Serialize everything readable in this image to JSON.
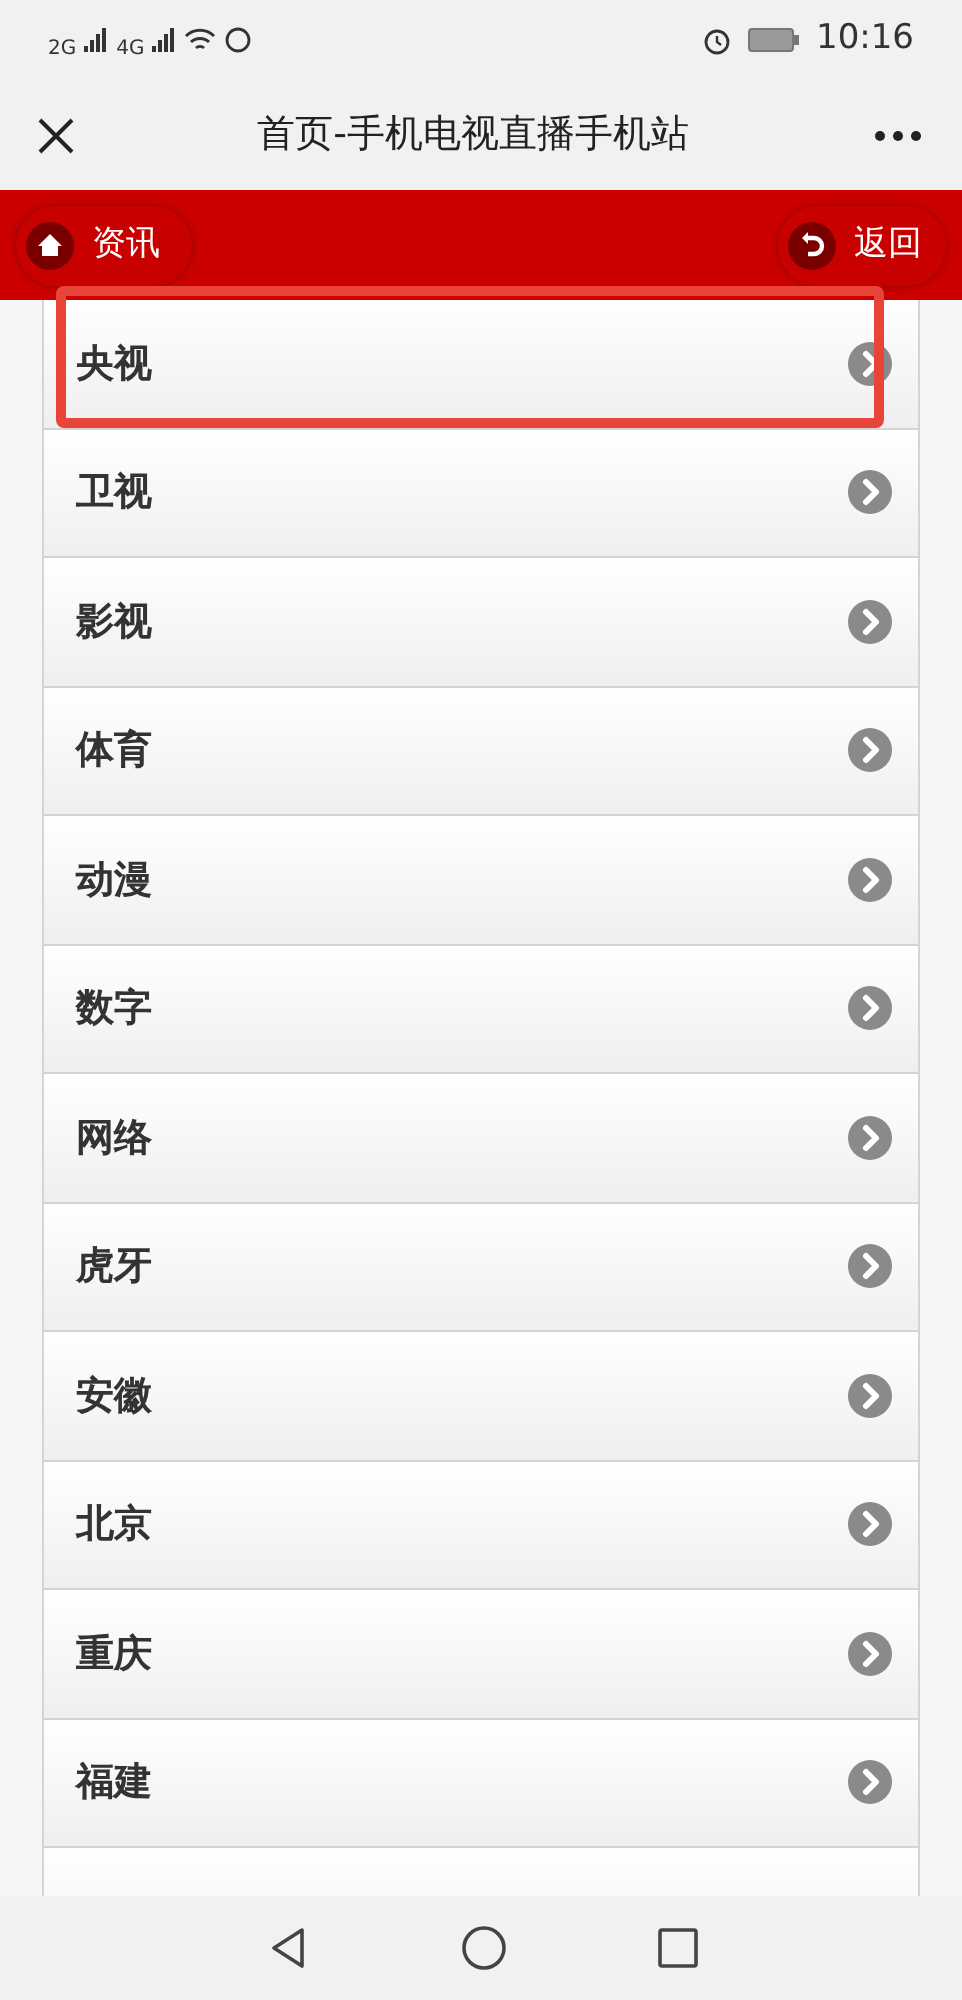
{
  "status_bar": {
    "signal_1": "2G",
    "signal_2": "4G",
    "time": "10:16"
  },
  "title_bar": {
    "title": "首页-手机电视直播手机站"
  },
  "header": {
    "left_button": "资讯",
    "right_button": "返回"
  },
  "categories": [
    {
      "label": "央视"
    },
    {
      "label": "卫视"
    },
    {
      "label": "影视"
    },
    {
      "label": "体育"
    },
    {
      "label": "动漫"
    },
    {
      "label": "数字"
    },
    {
      "label": "网络"
    },
    {
      "label": "虎牙"
    },
    {
      "label": "安徽"
    },
    {
      "label": "北京"
    },
    {
      "label": "重庆"
    },
    {
      "label": "福建"
    },
    {
      "kind": "cut"
    }
  ]
}
